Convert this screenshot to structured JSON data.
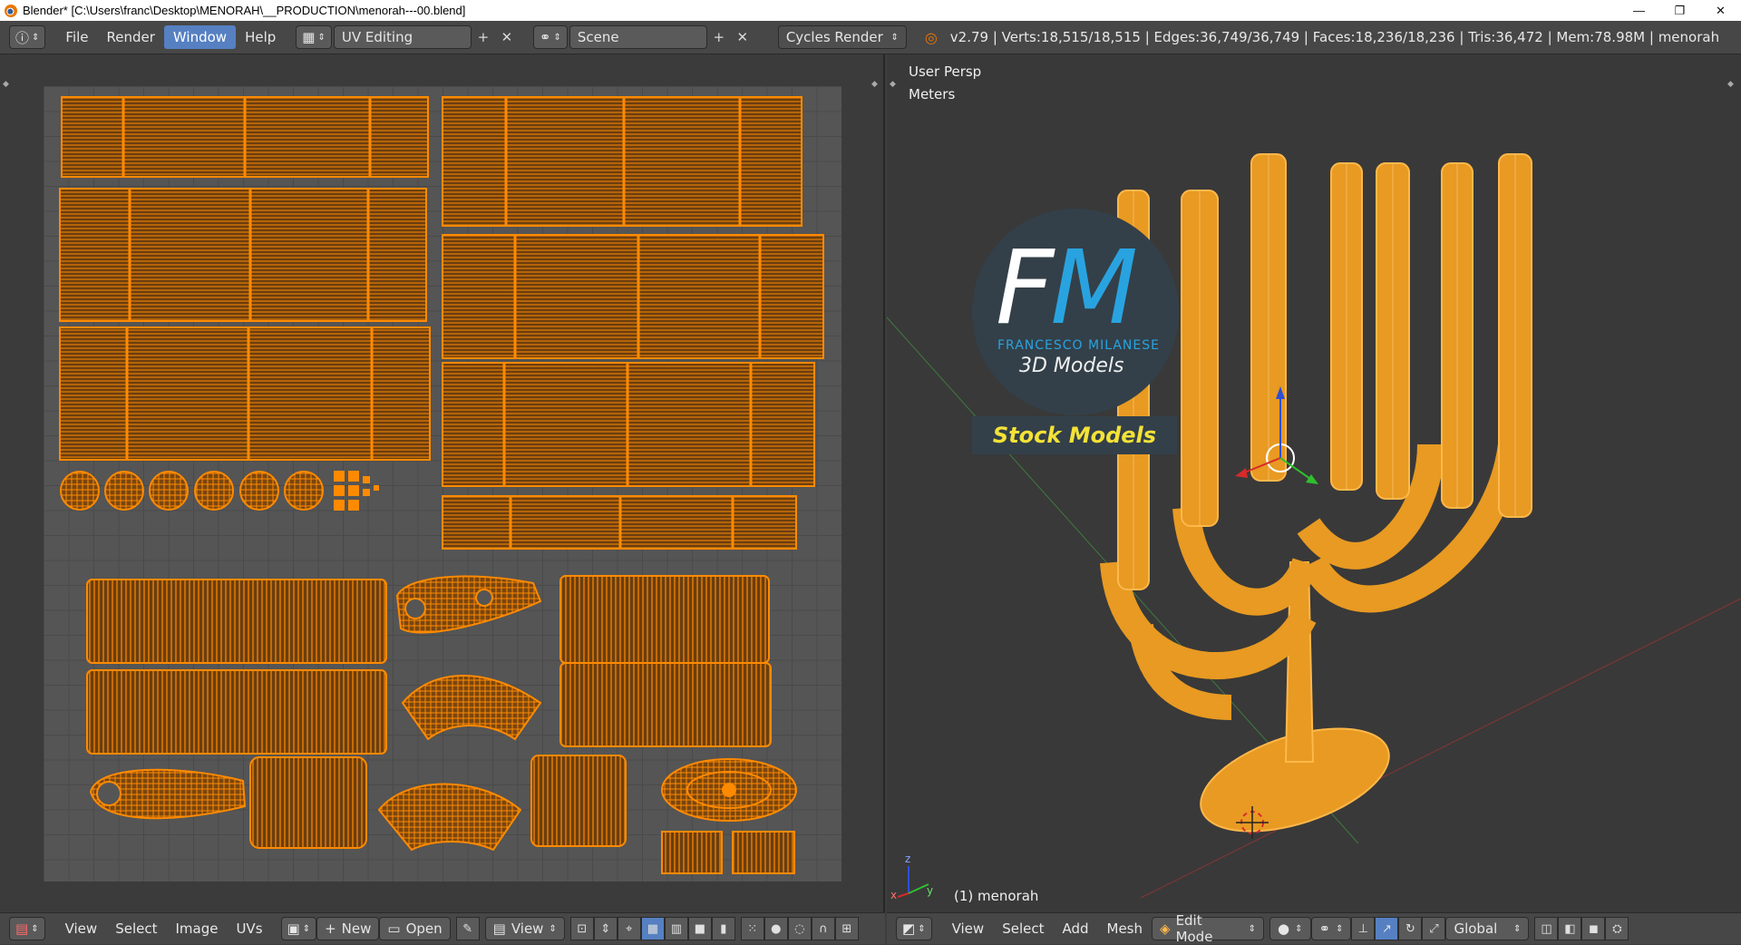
{
  "window": {
    "title": "Blender* [C:\\Users\\franc\\Desktop\\MENORAH\\__PRODUCTION\\menorah---00.blend]",
    "minimize": "—",
    "maximize": "❐",
    "close": "✕"
  },
  "top_header": {
    "menus": [
      "File",
      "Render",
      "Window",
      "Help"
    ],
    "active_menu": "Window",
    "screen_layout": "UV Editing",
    "scene": "Scene",
    "render_engine": "Cycles Render",
    "stats": "v2.79 | Verts:18,515/18,515 | Edges:36,749/36,749 | Faces:18,236/18,236 | Tris:36,472 | Mem:78.98M | menorah"
  },
  "uv_editor": {
    "header_menus": [
      "View",
      "Select",
      "Image",
      "UVs"
    ],
    "new_label": "New",
    "open_label": "Open",
    "view_label": "View"
  },
  "viewport": {
    "view_name": "User Persp",
    "units": "Meters",
    "object_label": "(1) menorah",
    "header_menus": [
      "View",
      "Select",
      "Add",
      "Mesh"
    ],
    "mode": "Edit Mode",
    "orientation": "Global",
    "axis_x": "x",
    "axis_y": "y",
    "axis_z": "z"
  },
  "watermark": {
    "letter_f": "F",
    "letter_m": "M",
    "name": "FRANCESCO MILANESE",
    "tagline": "3D Models",
    "banner": "Stock Models"
  },
  "colors": {
    "uv_wire": "#ff8a00",
    "mesh_orange": "#f5a623",
    "active_blue": "#5680c2",
    "brand_blue": "#29a3e0",
    "banner_yellow": "#f4e237"
  }
}
